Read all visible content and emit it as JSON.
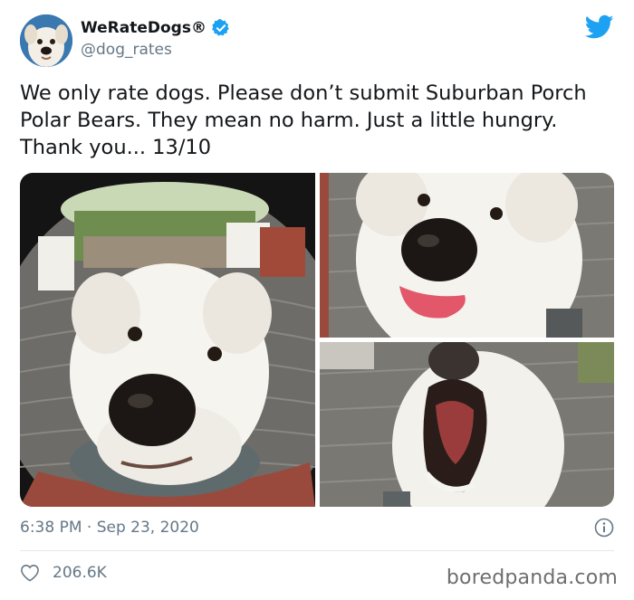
{
  "tweet": {
    "author": {
      "display_name": "WeRateDogs®",
      "handle": "@dog_rates",
      "verified": true
    },
    "text": "We only rate dogs. Please don’t submit Suburban Porch Polar Bears. They mean no harm. Just a little hungry. Thank you... 13/10",
    "timestamp": "6:38 PM · Sep 23, 2020",
    "likes": "206.6K"
  },
  "icons": {
    "brand": "twitter-bird-icon",
    "verified": "verified-badge-icon",
    "info": "info-icon",
    "like": "heart-icon"
  },
  "colors": {
    "twitter_blue": "#1da1f2",
    "text": "#14171a",
    "secondary_text": "#657786",
    "divider": "#e1e8ed"
  },
  "watermark": "boredpanda.com"
}
